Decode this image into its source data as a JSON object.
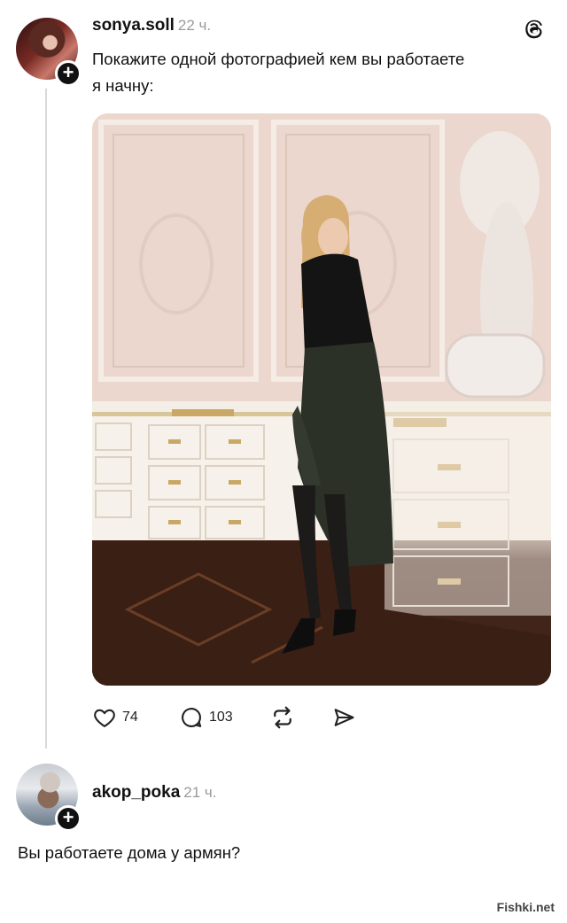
{
  "post": {
    "username": "sonya.soll",
    "time": "22 ч.",
    "text_line1": "Покажите одной фотографией кем вы работаете",
    "text_line2": "я начну:",
    "likes": "74",
    "replies": "103"
  },
  "reply": {
    "username": "akop_poka",
    "time": "21 ч.",
    "text": "Вы работаете дома у армян?"
  },
  "watermark": "Fishki.net",
  "icons": {
    "app_logo": "threads-logo-icon",
    "like": "heart-icon",
    "reply": "comment-bubble-icon",
    "repost": "repost-icon",
    "share": "send-icon",
    "follow": "plus-icon"
  },
  "colors": {
    "text": "#111111",
    "secondary": "#9a9a9a",
    "thread_line": "#d9d9d9"
  }
}
